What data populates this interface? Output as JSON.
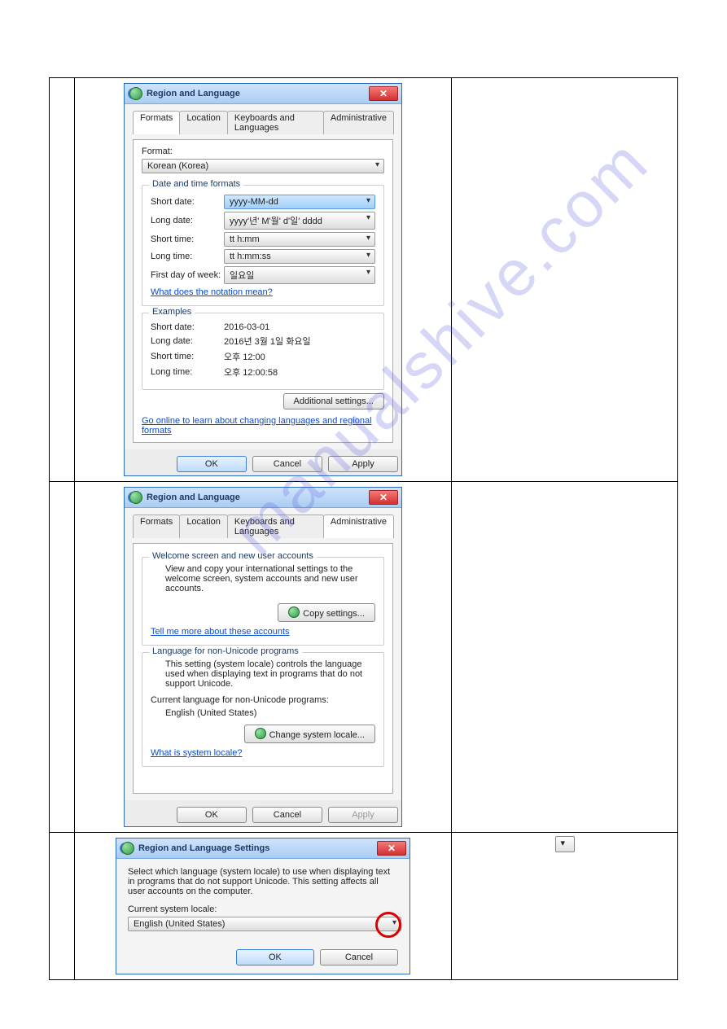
{
  "watermark": "manualshive.com",
  "dlg1": {
    "title": "Region and Language",
    "tabs": [
      "Formats",
      "Location",
      "Keyboards and Languages",
      "Administrative"
    ],
    "format_label": "Format:",
    "format_value": "Korean (Korea)",
    "datetime_group": "Date and time formats",
    "short_date_label": "Short date:",
    "short_date_value": "yyyy-MM-dd",
    "long_date_label": "Long date:",
    "long_date_value": "yyyy'년' M'월' d'일' dddd",
    "short_time_label": "Short time:",
    "short_time_value": "tt h:mm",
    "long_time_label": "Long time:",
    "long_time_value": "tt h:mm:ss",
    "first_day_label": "First day of week:",
    "first_day_value": "일요일",
    "notation_link": "What does the notation mean?",
    "examples_group": "Examples",
    "ex_short_date_l": "Short date:",
    "ex_short_date_v": "2016-03-01",
    "ex_long_date_l": "Long date:",
    "ex_long_date_v": "2016년 3월 1일 화요일",
    "ex_short_time_l": "Short time:",
    "ex_short_time_v": "오후 12:00",
    "ex_long_time_l": "Long time:",
    "ex_long_time_v": "오후 12:00:58",
    "additional_btn": "Additional settings...",
    "online_link": "Go online to learn about changing languages and regional formats",
    "ok": "OK",
    "cancel": "Cancel",
    "Apply": "Apply"
  },
  "dlg2": {
    "title": "Region and Language",
    "tabs": [
      "Formats",
      "Location",
      "Keyboards and Languages",
      "Administrative"
    ],
    "welcome_group": "Welcome screen and new user accounts",
    "welcome_text": "View and copy your international settings to the welcome screen, system accounts and new user accounts.",
    "copy_btn": "Copy settings...",
    "tell_link": "Tell me more about these accounts",
    "nonuni_group": "Language for non-Unicode programs",
    "nonuni_text": "This setting (system locale) controls the language used when displaying text in programs that do not support Unicode.",
    "current_label": "Current language for non-Unicode programs:",
    "current_value": "English (United States)",
    "change_btn": "Change system locale...",
    "what_link": "What is system locale?",
    "ok": "OK",
    "cancel": "Cancel",
    "Apply": "Apply"
  },
  "dlg3": {
    "title": "Region and Language Settings",
    "intro": "Select which language (system locale) to use when displaying text in programs that do not support Unicode. This setting affects all user accounts on the computer.",
    "locale_label": "Current system locale:",
    "locale_value": "English (United States)",
    "ok": "OK",
    "cancel": "Cancel"
  }
}
